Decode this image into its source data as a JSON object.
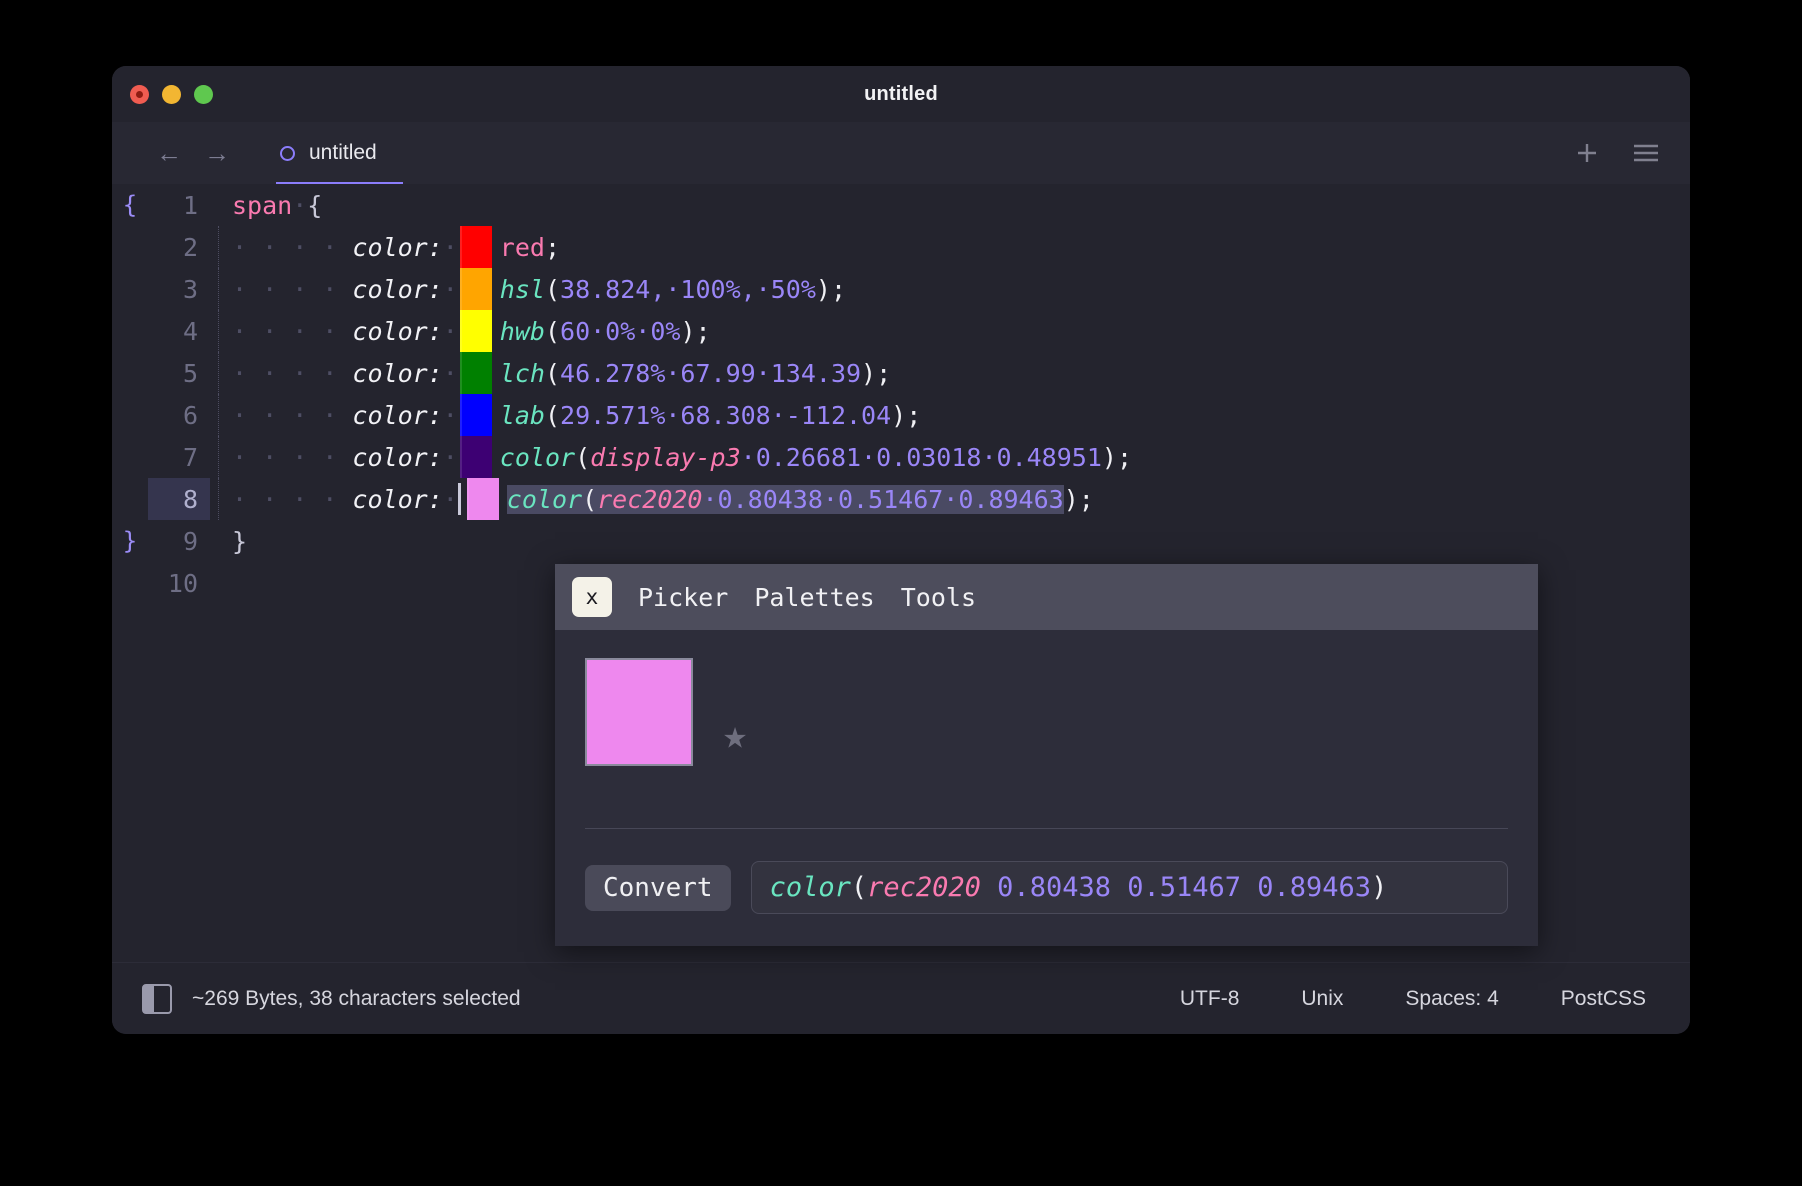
{
  "window": {
    "title": "untitled",
    "traffic_lights": [
      "close",
      "minimize",
      "zoom"
    ]
  },
  "tabbar": {
    "back_icon": "←",
    "forward_icon": "→",
    "tab_label": "untitled",
    "new_tab_icon": "plus-icon",
    "menu_icon": "hamburger-icon"
  },
  "editor": {
    "language": "PostCSS",
    "active_line": 8,
    "lines": [
      {
        "num": "1",
        "fold": "{",
        "indent": 0,
        "swatch": null,
        "text": "span·{"
      },
      {
        "num": "2",
        "fold": "",
        "indent": 4,
        "swatch": "#ff0000",
        "text": "color:· red;"
      },
      {
        "num": "3",
        "fold": "",
        "indent": 4,
        "swatch": "#ffa500",
        "text": "color:· hsl(38.824,·100%,·50%);"
      },
      {
        "num": "4",
        "fold": "",
        "indent": 4,
        "swatch": "#ffff00",
        "text": "color:· hwb(60·0%·0%);"
      },
      {
        "num": "5",
        "fold": "",
        "indent": 4,
        "swatch": "#008000",
        "text": "color:· lch(46.278%·67.99·134.39);"
      },
      {
        "num": "6",
        "fold": "",
        "indent": 4,
        "swatch": "#0000ff",
        "text": "color:· lab(29.571%·68.308·-112.04);"
      },
      {
        "num": "7",
        "fold": "",
        "indent": 4,
        "swatch": "#3d0073",
        "text": "color:· color(display-p3·0.26681·0.03018·0.48951);"
      },
      {
        "num": "8",
        "fold": "",
        "indent": 4,
        "swatch": "#ee88ee",
        "text": "color:· color(rec2020·0.80438·0.51467·0.89463);"
      },
      {
        "num": "9",
        "fold": "}",
        "indent": 0,
        "swatch": null,
        "text": "}"
      },
      {
        "num": "10",
        "fold": "",
        "indent": 0,
        "swatch": null,
        "text": ""
      }
    ],
    "line1": {
      "keyword": "span",
      "space_dot": "·",
      "brace": "{"
    },
    "line9": {
      "brace": "}"
    },
    "rows": [
      {
        "prop": "color:",
        "sep": "·",
        "value_plain": "red",
        "semi": ";"
      },
      {
        "prop": "color:",
        "sep": "·",
        "fn": "hsl",
        "args": "38.824,·100%,·50%",
        "semi": ";"
      },
      {
        "prop": "color:",
        "sep": "·",
        "fn": "hwb",
        "args": "60·0%·0%",
        "semi": ";"
      },
      {
        "prop": "color:",
        "sep": "·",
        "fn": "lch",
        "args": "46.278%·67.99·134.39",
        "semi": ";"
      },
      {
        "prop": "color:",
        "sep": "·",
        "fn": "lab",
        "args": "29.571%·68.308·-112.04",
        "semi": ";"
      },
      {
        "prop": "color:",
        "sep": "·",
        "fn": "color",
        "kw": "display-p3",
        "args": "·0.26681·0.03018·0.48951",
        "semi": ";"
      },
      {
        "prop": "color:",
        "sep": "·",
        "fn": "color",
        "kw": "rec2020",
        "args": "·0.80438·0.51467·0.89463",
        "semi": ";"
      }
    ]
  },
  "picker": {
    "close_label": "x",
    "tabs": [
      "Picker",
      "Palettes",
      "Tools"
    ],
    "current_color": "#ee88ee",
    "favorite_icon": "★",
    "convert_label": "Convert",
    "value": {
      "fn": "color",
      "open": "(",
      "space": "rec2020",
      "coords": " 0.80438 0.51467 0.89463",
      "close": ")"
    }
  },
  "statusbar": {
    "sidebar_icon": "panel-icon",
    "info": "~269 Bytes, 38 characters selected",
    "encoding": "UTF-8",
    "line_ending": "Unix",
    "indent": "Spaces: 4",
    "syntax": "PostCSS"
  },
  "colors": {
    "accent": "#8b7dfb",
    "selector": "#fa7ab0",
    "function": "#6ae5c0",
    "number": "#9a86f7",
    "keyword": "#fa7ab0",
    "background": "#24242e",
    "popup_bg": "#2d2d3a",
    "popup_header": "#4d4d5c"
  }
}
